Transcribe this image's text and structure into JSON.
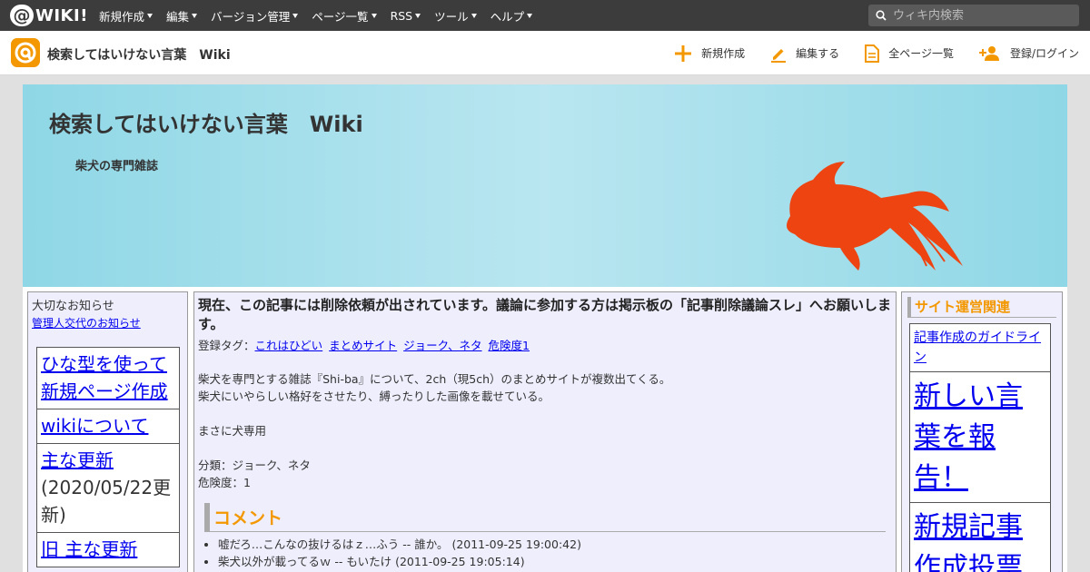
{
  "topbar": {
    "logo_text": "WIKI!",
    "menu": [
      {
        "label": "新規作成"
      },
      {
        "label": "編集"
      },
      {
        "label": "バージョン管理"
      },
      {
        "label": "ページ一覧"
      },
      {
        "label": "RSS"
      },
      {
        "label": "ツール"
      },
      {
        "label": "ヘルプ"
      }
    ],
    "search_placeholder": "ウィキ内検索"
  },
  "sitebar": {
    "title": "検索してはいけない言葉　Wiki",
    "actions": {
      "new": "新規作成",
      "edit": "編集する",
      "all_pages": "全ページ一覧",
      "login": "登録/ログイン"
    }
  },
  "banner": {
    "title": "検索してはいけない言葉　Wiki",
    "subtitle": "柴犬の専門雑誌"
  },
  "left": {
    "notice_heading": "大切なお知らせ",
    "notice_link": "管理人交代のお知らせ",
    "links": {
      "template": "ひな型を使って新規ページ作成",
      "about": "wikiについて",
      "updates": "主な更新",
      "updates_date": "(2020/05/22更新)",
      "old_updates": "旧 主な更新"
    }
  },
  "main": {
    "title": "現在、この記事には削除依頼が出されています。議論に参加する方は掲示板の「記事削除議論スレ」へお願いします。",
    "tags_label": "登録タグ：",
    "tags": [
      "これはひどい",
      "まとめサイト",
      "ジョーク、ネタ",
      "危険度1"
    ],
    "para1": "柴犬を専門とする雑誌『Shi-ba』について、2ch（現5ch）のまとめサイトが複数出てくる。",
    "para2": "柴犬にいやらしい格好をさせたり、縛ったりした画像を載せている。",
    "para3": "まさに犬専用",
    "category": "分類：ジョーク、ネタ",
    "danger": "危険度：1",
    "comment_heading": "コメント",
    "comments": [
      "嘘だろ…こんなの抜けるはｚ…ふう -- 誰か。 (2011-09-25 19:00:42)",
      "柴犬以外が載ってるｗ -- もいたけ (2011-09-25 19:05:14)"
    ]
  },
  "right": {
    "heading": "サイト運営関連",
    "guideline": "記事作成のガイドライン",
    "report": "新しい言葉を報告！",
    "vote": "新規記事作成投票"
  }
}
